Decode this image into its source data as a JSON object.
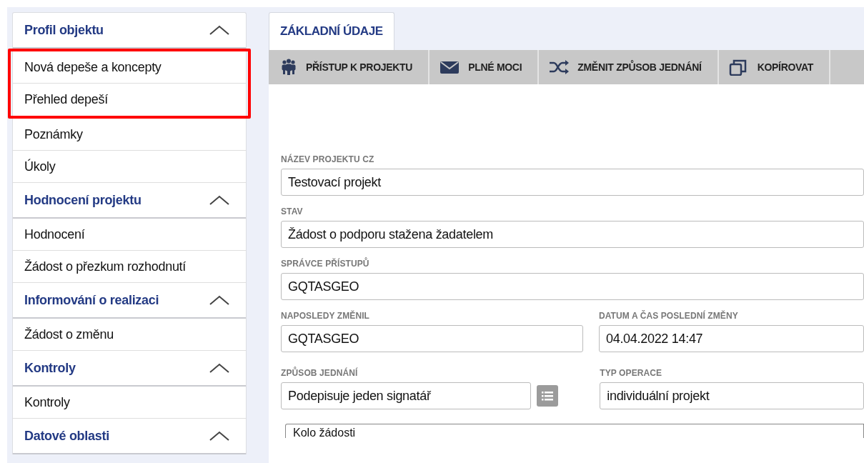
{
  "sidebar": {
    "sections": [
      {
        "title": "Profil objektu",
        "expanded": true,
        "items": [
          {
            "label": "Nová depeše a koncepty",
            "highlighted": true
          },
          {
            "label": "Přehled depeší",
            "highlighted": true
          },
          {
            "label": "Poznámky",
            "highlighted": false
          },
          {
            "label": "Úkoly",
            "highlighted": false
          }
        ]
      },
      {
        "title": "Hodnocení projektu",
        "expanded": true,
        "items": [
          {
            "label": "Hodnocení",
            "highlighted": false
          },
          {
            "label": "Žádost o přezkum rozhodnutí",
            "highlighted": false
          }
        ]
      },
      {
        "title": "Informování o realizaci",
        "expanded": true,
        "items": [
          {
            "label": "Žádost o změnu",
            "highlighted": false
          }
        ]
      },
      {
        "title": "Kontroly",
        "expanded": true,
        "items": [
          {
            "label": "Kontroly",
            "highlighted": false
          }
        ]
      },
      {
        "title": "Datové oblasti",
        "expanded": true
      }
    ]
  },
  "tabs": [
    {
      "label": "ZÁKLADNÍ ÚDAJE",
      "selected": true
    }
  ],
  "toolbar": [
    "PŘÍSTUP K PROJEKTU",
    "PLNÉ MOCI",
    "ZMĚNIT ZPŮSOB JEDNÁNÍ",
    "KOPÍROVAT"
  ],
  "form": {
    "rows": [
      [
        {
          "label": "NÁZEV PROJEKTU CZ",
          "value": "Testovací projekt",
          "picker": false
        }
      ],
      [
        {
          "label": "STAV",
          "value": "Žádost o podporu stažena žadatelem",
          "picker": false
        }
      ],
      [
        {
          "label": "SPRÁVCE PŘÍSTUPŮ",
          "value": "GQTASGEO",
          "picker": false
        }
      ],
      [
        {
          "label": "NAPOSLEDY ZMĚNIL",
          "value": "GQTASGEO",
          "picker": false
        },
        {
          "label": "DATUM A ČAS POSLEDNÍ ZMĚNY",
          "value": "04.04.2022 14:47",
          "picker": false
        }
      ],
      [
        {
          "label": "ZPŮSOB JEDNÁNÍ",
          "value": "Podepisuje jeden signatář",
          "picker": true
        },
        {
          "label": "TYP OPERACE",
          "value": "individuální projekt",
          "picker": false
        }
      ]
    ],
    "fieldset": {
      "legend": "Kolo žádosti"
    }
  }
}
